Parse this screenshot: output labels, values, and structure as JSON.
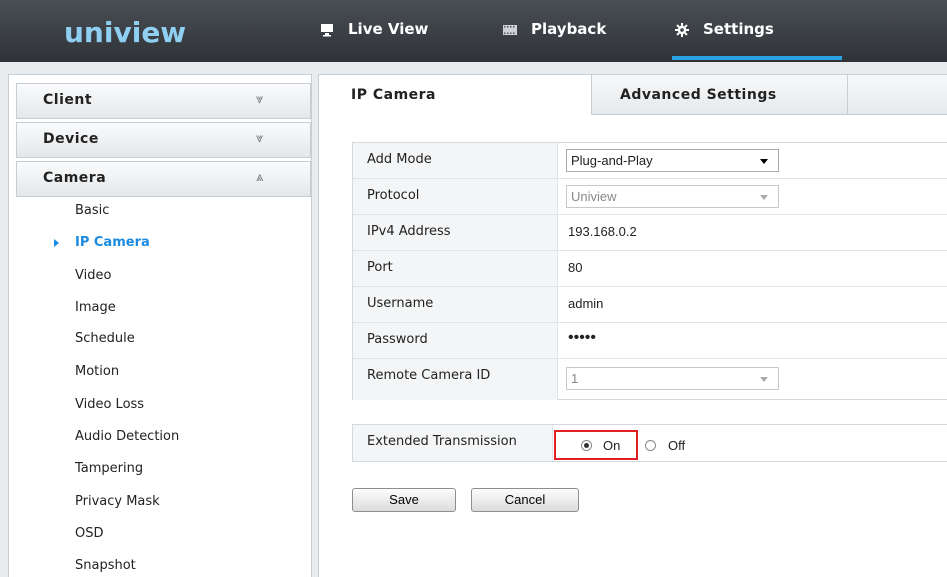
{
  "brand": {
    "logo": "uniview"
  },
  "topnav": {
    "items": [
      {
        "label": "Live View",
        "icon": "monitor-icon"
      },
      {
        "label": "Playback",
        "icon": "film-icon"
      },
      {
        "label": "Settings",
        "icon": "gear-icon",
        "active": true
      }
    ]
  },
  "sidebar": {
    "sections": [
      {
        "label": "Client",
        "chevron": "»",
        "expanded": false
      },
      {
        "label": "Device",
        "chevron": "»",
        "expanded": false
      },
      {
        "label": "Camera",
        "chevron": "«",
        "expanded": true
      }
    ],
    "camera_items": [
      "Basic",
      "IP Camera",
      "Video",
      "Image",
      "Schedule",
      "Motion",
      "Video Loss",
      "Audio Detection",
      "Tampering",
      "Privacy Mask",
      "OSD",
      "Snapshot"
    ],
    "active_item": "IP Camera"
  },
  "tabs": [
    "IP Camera",
    "Advanced Settings"
  ],
  "form": {
    "add_mode": {
      "label": "Add Mode",
      "value": "Plug-and-Play"
    },
    "protocol": {
      "label": "Protocol",
      "value": "Uniview"
    },
    "ipv4": {
      "label": "IPv4 Address",
      "value": "193.168.0.2"
    },
    "port": {
      "label": "Port",
      "value": "80"
    },
    "username": {
      "label": "Username",
      "value": "admin"
    },
    "password": {
      "label": "Password",
      "value": "•••••"
    },
    "remote_id": {
      "label": "Remote Camera ID",
      "value": "1"
    }
  },
  "extended": {
    "label": "Extended Transmission",
    "on_label": "On",
    "off_label": "Off",
    "selected": "On"
  },
  "buttons": {
    "save": "Save",
    "cancel": "Cancel"
  },
  "colors": {
    "accent": "#2aa3e6",
    "active_link": "#1a8be0",
    "highlight_border": "#e02020"
  }
}
